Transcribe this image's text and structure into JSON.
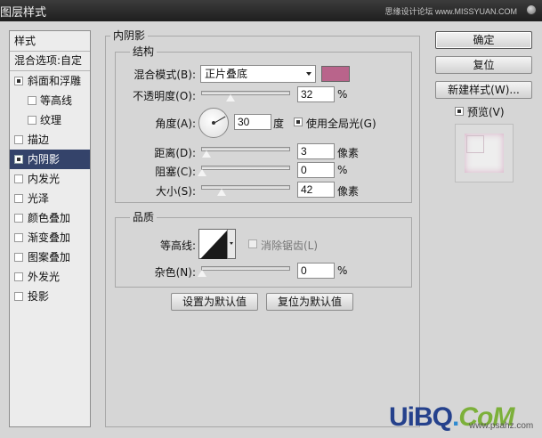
{
  "window": {
    "title": "图层样式",
    "watermark": "思缘设计论坛 www.MISSYUAN.COM"
  },
  "sidebar": {
    "header": "样式",
    "items": [
      {
        "label": "混合选项:自定",
        "checkbox": "none",
        "checked": false,
        "selected": false
      },
      {
        "label": "斜面和浮雕",
        "checkbox": "yes",
        "checked": true,
        "selected": false
      },
      {
        "label": "等高线",
        "checkbox": "yes",
        "checked": false,
        "selected": false
      },
      {
        "label": "纹理",
        "checkbox": "yes",
        "checked": false,
        "selected": false
      },
      {
        "label": "描边",
        "checkbox": "yes",
        "checked": false,
        "selected": false
      },
      {
        "label": "内阴影",
        "checkbox": "yes",
        "checked": true,
        "selected": true
      },
      {
        "label": "内发光",
        "checkbox": "yes",
        "checked": false,
        "selected": false
      },
      {
        "label": "光泽",
        "checkbox": "yes",
        "checked": false,
        "selected": false
      },
      {
        "label": "颜色叠加",
        "checkbox": "yes",
        "checked": false,
        "selected": false
      },
      {
        "label": "渐变叠加",
        "checkbox": "yes",
        "checked": false,
        "selected": false
      },
      {
        "label": "图案叠加",
        "checkbox": "yes",
        "checked": false,
        "selected": false
      },
      {
        "label": "外发光",
        "checkbox": "yes",
        "checked": false,
        "selected": false
      },
      {
        "label": "投影",
        "checkbox": "yes",
        "checked": false,
        "selected": false
      }
    ]
  },
  "panel": {
    "title": "内阴影",
    "structure": {
      "title": "结构",
      "blend_mode_label": "混合模式(B):",
      "blend_mode_value": "正片叠底",
      "color": "#b9648b",
      "opacity_label": "不透明度(O):",
      "opacity_value": "32",
      "opacity_unit": "%",
      "angle_label": "角度(A):",
      "angle_value": "30",
      "angle_unit": "度",
      "use_global_light_label": "使用全局光(G)",
      "use_global_light_checked": true,
      "distance_label": "距离(D):",
      "distance_value": "3",
      "distance_unit": "像素",
      "choke_label": "阻塞(C):",
      "choke_value": "0",
      "choke_unit": "%",
      "size_label": "大小(S):",
      "size_value": "42",
      "size_unit": "像素"
    },
    "quality": {
      "title": "品质",
      "contour_label": "等高线:",
      "anti_aliased_label": "消除锯齿(L)",
      "noise_label": "杂色(N):",
      "noise_value": "0",
      "noise_unit": "%"
    },
    "make_default_label": "设置为默认值",
    "reset_default_label": "复位为默认值"
  },
  "buttons": {
    "ok": "确定",
    "reset": "复位",
    "new_style": "新建样式(W)...",
    "preview_label": "预览(V)",
    "preview_checked": true
  },
  "branding": {
    "logo_a": "UiBQ",
    "logo_b": ".",
    "logo_c": "CoM",
    "url": "www.psahz.com"
  }
}
